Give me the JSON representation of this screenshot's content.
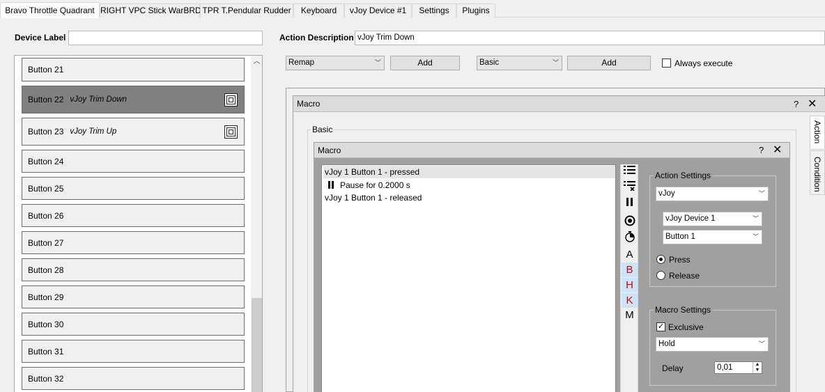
{
  "tabs": [
    {
      "label": "Bravo Throttle Quadrant",
      "active": true
    },
    {
      "label": "RIGHT VPC Stick WarBRD",
      "active": false
    },
    {
      "label": "TPR T.Pendular Rudder",
      "active": false
    },
    {
      "label": "Keyboard",
      "active": false
    },
    {
      "label": "vJoy Device #1",
      "active": false
    },
    {
      "label": "Settings",
      "active": false
    },
    {
      "label": "Plugins",
      "active": false
    }
  ],
  "device_label": {
    "label": "Device Label",
    "value": ""
  },
  "action_description": {
    "label": "Action Description",
    "value": "vJoy Trim Down"
  },
  "buttons": [
    {
      "label": "Button 21",
      "action": "",
      "selected": false,
      "icon": ""
    },
    {
      "label": "Button 22",
      "action": "vJoy Trim Down",
      "selected": true,
      "icon": "macro-icon"
    },
    {
      "label": "Button 23",
      "action": "vJoy Trim Up",
      "selected": false,
      "icon": "macro-icon"
    },
    {
      "label": "Button 24",
      "action": "",
      "selected": false,
      "icon": ""
    },
    {
      "label": "Button 25",
      "action": "",
      "selected": false,
      "icon": ""
    },
    {
      "label": "Button 26",
      "action": "",
      "selected": false,
      "icon": ""
    },
    {
      "label": "Button 27",
      "action": "",
      "selected": false,
      "icon": ""
    },
    {
      "label": "Button 28",
      "action": "",
      "selected": false,
      "icon": ""
    },
    {
      "label": "Button 29",
      "action": "",
      "selected": false,
      "icon": ""
    },
    {
      "label": "Button 30",
      "action": "",
      "selected": false,
      "icon": ""
    },
    {
      "label": "Button 31",
      "action": "",
      "selected": false,
      "icon": ""
    },
    {
      "label": "Button 32",
      "action": "",
      "selected": false,
      "icon": ""
    }
  ],
  "toolbar": {
    "action_type": "Remap",
    "add_action_label": "Add",
    "container_type": "Basic",
    "add_container_label": "Add",
    "always_execute_label": "Always execute",
    "always_execute_checked": false
  },
  "outer_macro": {
    "title": "Macro",
    "help": "?",
    "close": "✕",
    "group_label": "Basic"
  },
  "side_tabs": [
    {
      "label": "Action",
      "active": true
    },
    {
      "label": "Condition",
      "active": false
    }
  ],
  "inner_macro": {
    "title": "Macro",
    "help": "?",
    "close": "✕",
    "items": [
      {
        "text": "vJoy 1 Button 1 - pressed",
        "type": "action",
        "selected": true
      },
      {
        "text": "Pause for 0.2000 s",
        "type": "pause",
        "selected": false
      },
      {
        "text": "vJoy 1 Button 1 - released",
        "type": "action",
        "selected": false
      }
    ]
  },
  "macro_tools": [
    {
      "icon": "add-action-icon",
      "glyph": "",
      "highlighted": false
    },
    {
      "icon": "remove-action-icon",
      "glyph": "",
      "highlighted": false
    },
    {
      "icon": "pause-icon",
      "glyph": "",
      "highlighted": false
    },
    {
      "icon": "record-icon",
      "glyph": "",
      "highlighted": false
    },
    {
      "icon": "timer-icon",
      "glyph": "",
      "highlighted": false
    },
    {
      "icon": "axis-icon",
      "glyph": "A",
      "highlighted": false
    },
    {
      "icon": "button-icon",
      "glyph": "B",
      "highlighted": true
    },
    {
      "icon": "hat-icon",
      "glyph": "H",
      "highlighted": true
    },
    {
      "icon": "key-icon",
      "glyph": "K",
      "highlighted": true
    },
    {
      "icon": "mouse-icon",
      "glyph": "M",
      "highlighted": false
    }
  ],
  "action_settings": {
    "title": "Action Settings",
    "type": "vJoy",
    "device": "vJoy Device 1",
    "input": "Button 1",
    "press_label": "Press",
    "release_label": "Release",
    "mode": "Press"
  },
  "macro_settings": {
    "title": "Macro Settings",
    "exclusive_label": "Exclusive",
    "exclusive_checked": true,
    "repeat_mode": "Hold",
    "delay_label": "Delay",
    "delay_value": "0,01"
  },
  "colors": {
    "selected_row": "#808080",
    "highlight_tool": "#cce4f7",
    "highlight_glyph": "#d80000",
    "settings_bg": "#a0a0a0"
  }
}
